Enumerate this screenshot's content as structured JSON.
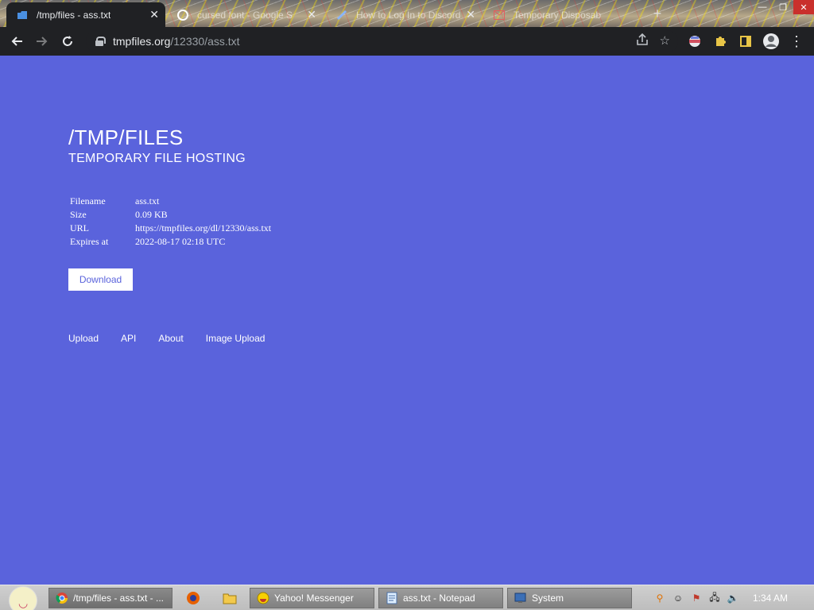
{
  "browser": {
    "tabs": [
      {
        "title": "/tmp/files - ass.txt",
        "icon": "tmpfiles-favicon",
        "active": true
      },
      {
        "title": "cursed font - Google S",
        "icon": "google-icon",
        "active": false
      },
      {
        "title": "How to Log In to Discord",
        "icon": "discord-icon",
        "active": false
      },
      {
        "title": "Temporary Disposable",
        "icon": "mail-icon",
        "active": false
      }
    ],
    "url_host": "tmpfiles.org",
    "url_path": "/12330/ass.txt"
  },
  "page": {
    "title": "/TMP/FILES",
    "subtitle": "TEMPORARY FILE HOSTING",
    "info": [
      {
        "key": "Filename",
        "value": "ass.txt"
      },
      {
        "key": "Size",
        "value": "0.09 KB"
      },
      {
        "key": "URL",
        "value": "https://tmpfiles.org/dl/12330/ass.txt"
      },
      {
        "key": "Expires at",
        "value": "2022-08-17 02:18 UTC"
      }
    ],
    "download_label": "Download",
    "footer_links": [
      "Upload",
      "API",
      "About",
      "Image Upload"
    ]
  },
  "taskbar": {
    "tasks": [
      {
        "label": "/tmp/files - ass.txt - ...",
        "icon": "chrome-icon"
      },
      {
        "label": "Yahoo! Messenger",
        "icon": "yahoo-messenger-icon"
      },
      {
        "label": "ass.txt - Notepad",
        "icon": "notepad-icon"
      },
      {
        "label": "System",
        "icon": "system-icon"
      }
    ],
    "clock": "1:34 AM"
  },
  "colors": {
    "page_bg": "#5a63dc",
    "chrome_bg": "#202124"
  }
}
